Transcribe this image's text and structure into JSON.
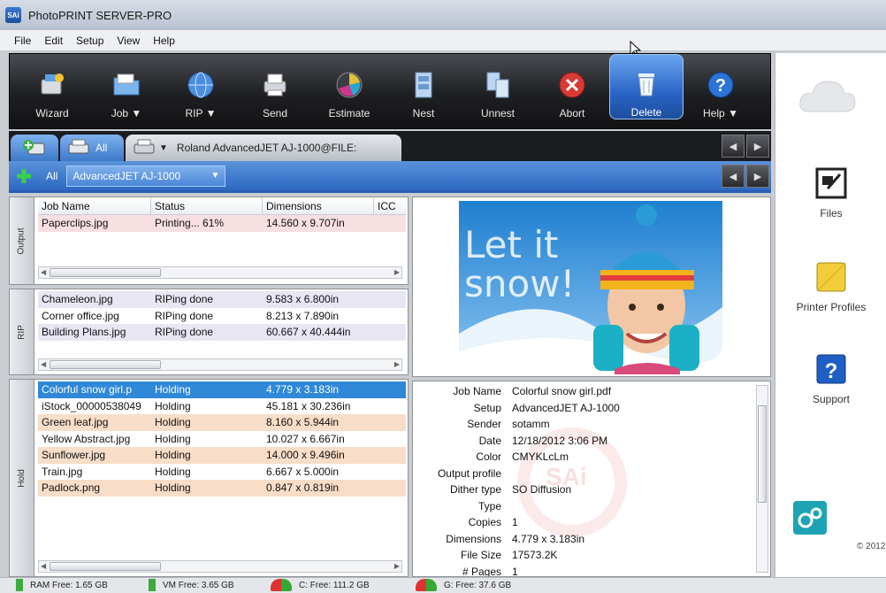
{
  "window": {
    "title": "PhotoPRINT SERVER-PRO",
    "app_icon_text": "SAi"
  },
  "menu": [
    "File",
    "Edit",
    "Setup",
    "View",
    "Help"
  ],
  "toolbar": [
    {
      "label": "Wizard",
      "icon": "wizard-icon"
    },
    {
      "label": "Job",
      "icon": "folder-icon",
      "dropdown": true
    },
    {
      "label": "RIP",
      "icon": "globe-icon",
      "dropdown": true
    },
    {
      "label": "Send",
      "icon": "printer-icon"
    },
    {
      "label": "Estimate",
      "icon": "estimate-icon"
    },
    {
      "label": "Nest",
      "icon": "nest-icon"
    },
    {
      "label": "Unnest",
      "icon": "unnest-icon"
    },
    {
      "label": "Abort",
      "icon": "abort-icon"
    },
    {
      "label": "Delete",
      "icon": "trash-icon",
      "active": true
    },
    {
      "label": "Help",
      "icon": "help-icon",
      "dropdown": true
    }
  ],
  "tabs": {
    "all_label": "All",
    "printer_tab": "Roland AdvancedJET AJ-1000@FILE:"
  },
  "subbar": {
    "all_label": "All",
    "printer": "AdvancedJET AJ-1000"
  },
  "columns": [
    "Job Name",
    "Status",
    "Dimensions",
    "ICC"
  ],
  "queues": {
    "output": {
      "label": "Output",
      "rows": [
        {
          "name": "Paperclips.jpg",
          "status": "Printing... 61%",
          "dims": "14.560 x 9.707in",
          "style": "pink"
        }
      ]
    },
    "rip": {
      "label": "RIP",
      "rows": [
        {
          "name": "Chameleon.jpg",
          "status": "RIPing done",
          "dims": "9.583 x 6.800in",
          "style": "lav"
        },
        {
          "name": "Corner office.jpg",
          "status": "RIPing done",
          "dims": "8.213 x 7.890in",
          "style": "plain"
        },
        {
          "name": "Building Plans.jpg",
          "status": "RIPing done",
          "dims": "60.667 x 40.444in",
          "style": "lav"
        }
      ]
    },
    "hold": {
      "label": "Hold",
      "rows": [
        {
          "name": "Colorful snow girl.p",
          "status": "Holding",
          "dims": "4.779 x 3.183in",
          "style": "sel"
        },
        {
          "name": "iStock_00000538049",
          "status": "Holding",
          "dims": "45.181 x 30.236in",
          "style": "plain"
        },
        {
          "name": "Green leaf.jpg",
          "status": "Holding",
          "dims": "8.160 x 5.944in",
          "style": "peach"
        },
        {
          "name": "Yellow Abstract.jpg",
          "status": "Holding",
          "dims": "10.027 x 6.667in",
          "style": "plain"
        },
        {
          "name": "Sunflower.jpg",
          "status": "Holding",
          "dims": "14.000 x 9.496in",
          "style": "peach"
        },
        {
          "name": "Train.jpg",
          "status": "Holding",
          "dims": "6.667 x 5.000in",
          "style": "plain"
        },
        {
          "name": "Padlock.png",
          "status": "Holding",
          "dims": "0.847 x 0.819in",
          "style": "peach"
        }
      ]
    }
  },
  "preview": {
    "text_line1": "Let it",
    "text_line2": "snow!"
  },
  "details": [
    {
      "key": "Job Name",
      "value": "Colorful snow girl.pdf"
    },
    {
      "key": "Setup",
      "value": "AdvancedJET AJ-1000"
    },
    {
      "key": "Sender",
      "value": "sotamm"
    },
    {
      "key": "Date",
      "value": "12/18/2012 3:06 PM"
    },
    {
      "key": "Color",
      "value": "CMYKLcLm"
    },
    {
      "key": "Output profile",
      "value": ""
    },
    {
      "key": "Dither type",
      "value": "SO Diffusion"
    },
    {
      "key": "Type",
      "value": ""
    },
    {
      "key": "Copies",
      "value": "1"
    },
    {
      "key": "Dimensions",
      "value": "4.779 x 3.183in"
    },
    {
      "key": "File Size",
      "value": "17573.2K"
    },
    {
      "key": "# Pages",
      "value": "1"
    }
  ],
  "watermark_text": "SAi",
  "sidebar": [
    {
      "label": "Files",
      "icon": "files-icon"
    },
    {
      "label": "Printer Profiles",
      "icon": "printer-profiles-icon"
    },
    {
      "label": "Support",
      "icon": "support-icon"
    }
  ],
  "copyright": "© 2012",
  "status": {
    "ram": "RAM Free: 1.65 GB",
    "vm": "VM Free: 3.65 GB",
    "c_drive": "C: Free: 111.2 GB",
    "g_drive": "G: Free: 37.6 GB"
  },
  "colors": {
    "accent": "#2f88d8",
    "toolbar_bg": "#1e1f22",
    "hold_row": "#f8ddc8",
    "output_row": "#f8dfe2",
    "rip_row": "#e9e6f4"
  }
}
